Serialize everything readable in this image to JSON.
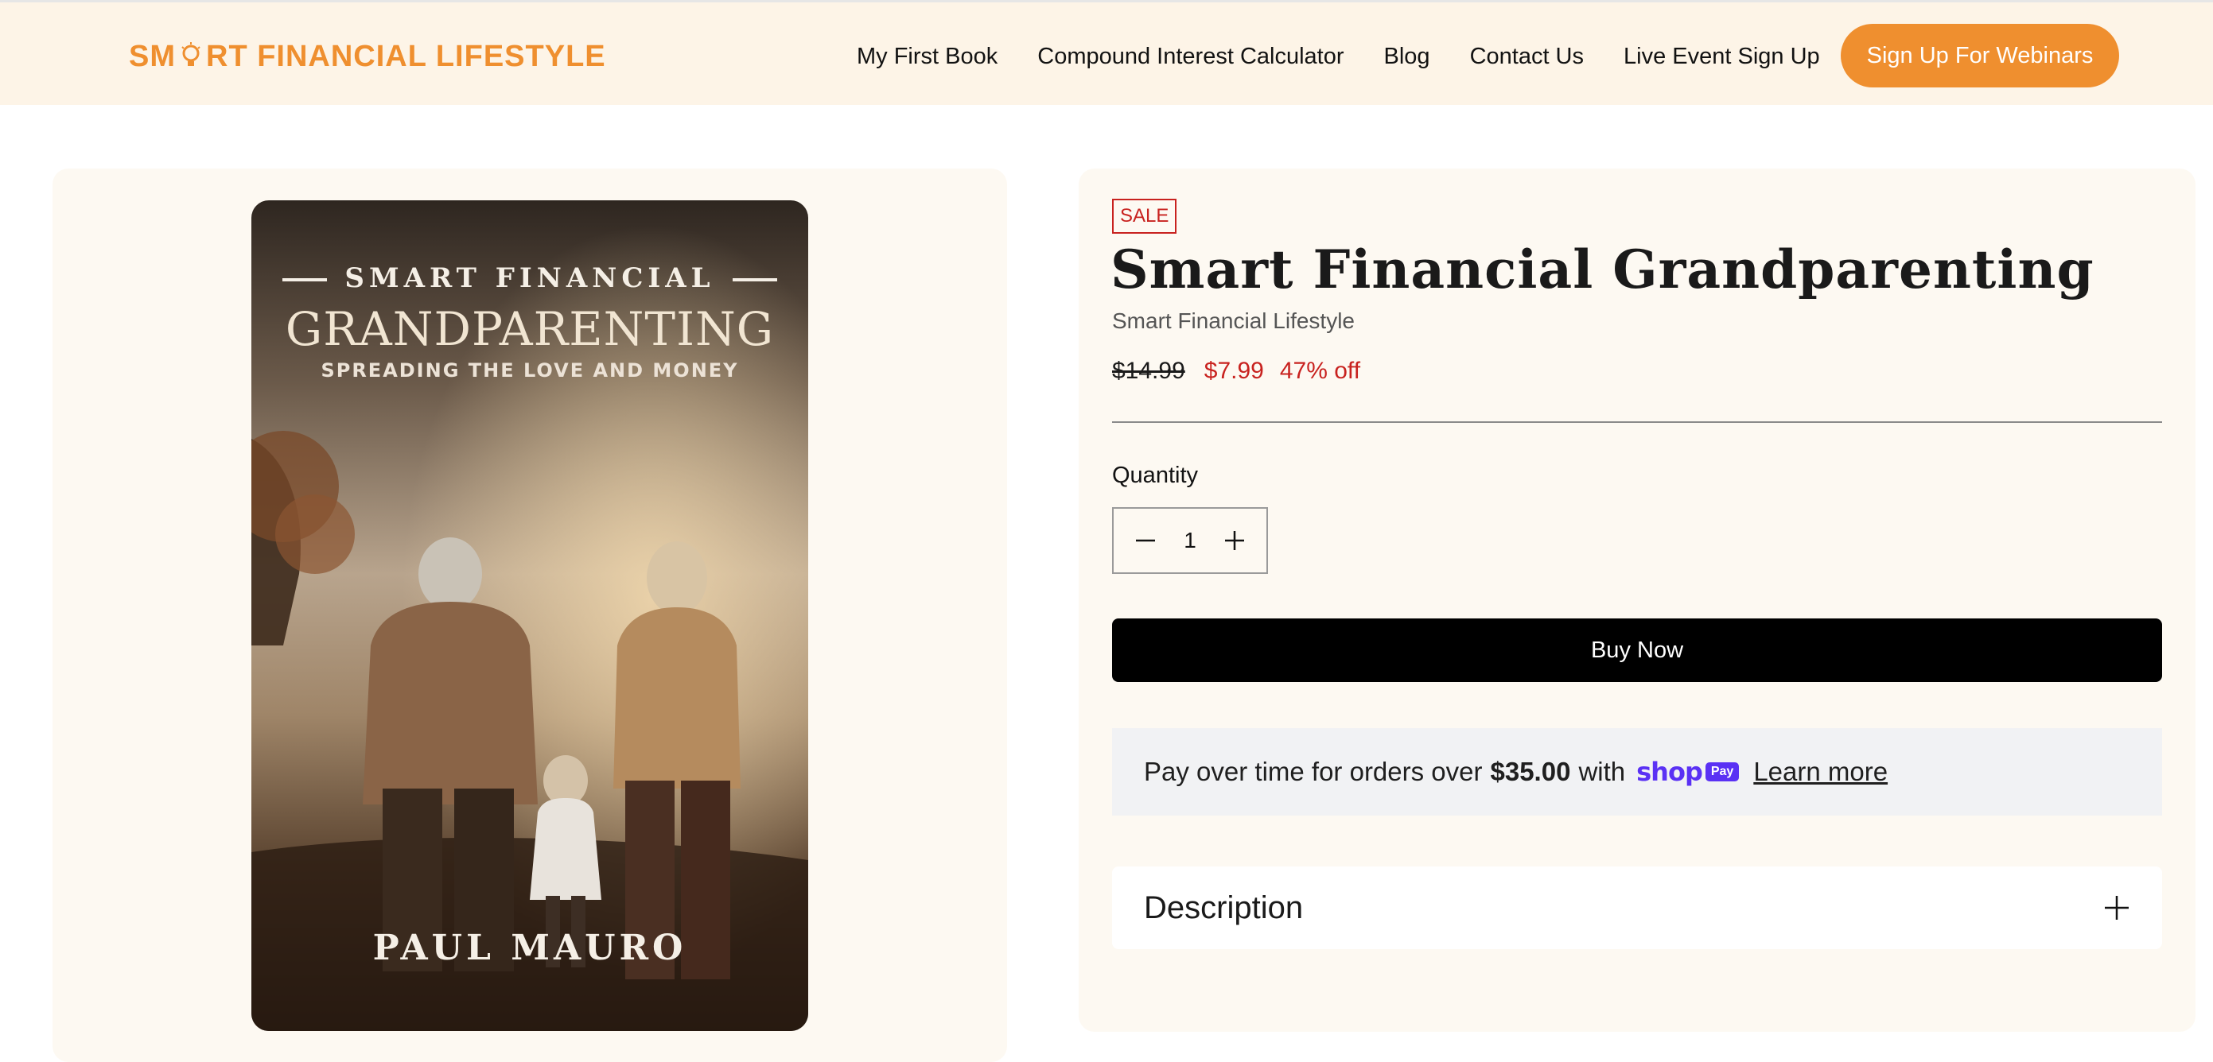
{
  "header": {
    "logo_text_pre": "SM",
    "logo_text_post": "RT FINANCIAL LIFESTYLE",
    "nav": [
      {
        "label": "My First Book"
      },
      {
        "label": "Compound Interest Calculator"
      },
      {
        "label": "Blog"
      },
      {
        "label": "Contact Us"
      },
      {
        "label": "Live Event Sign Up"
      }
    ],
    "cta_label": "Sign Up For Webinars"
  },
  "product": {
    "cover": {
      "top_line": "SMART FINANCIAL",
      "main_line": "GRANDPARENTING",
      "subtitle": "SPREADING THE LOVE AND MONEY",
      "author": "PAUL MAURO"
    },
    "badge": "SALE",
    "title": "Smart Financial Grandparenting",
    "vendor": "Smart Financial Lifestyle",
    "price_original": "$14.99",
    "price_sale": "$7.99",
    "discount": "47% off",
    "quantity_label": "Quantity",
    "quantity_value": "1",
    "buy_label": "Buy Now",
    "installments": {
      "text_before": "Pay over time for orders over",
      "amount": "$35.00",
      "text_after": "with",
      "shop_word": "shop",
      "pay_chip": "Pay",
      "learn_more": "Learn more"
    },
    "description_label": "Description"
  },
  "colors": {
    "brand_orange": "#ef8f2f",
    "header_bg": "#fdf4e7",
    "sale_red": "#c8221f",
    "shop_purple": "#5a31f4"
  },
  "icons": {
    "logo_bulb": "lightbulb-icon",
    "qty_minus": "minus-icon",
    "qty_plus": "plus-icon",
    "description_toggle": "plus-icon"
  }
}
